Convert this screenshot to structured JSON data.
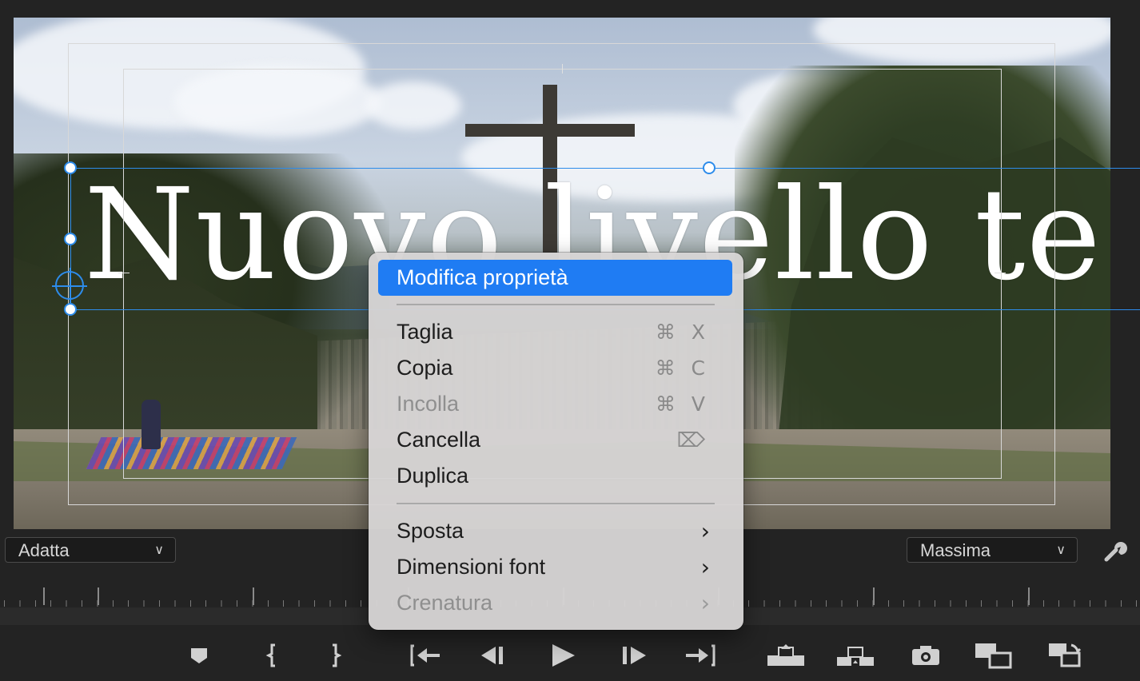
{
  "overlay_text": "Nuovo livello te",
  "zoom_select": {
    "value": "Adatta"
  },
  "quality_select": {
    "value": "Massima"
  },
  "context_menu": {
    "items": [
      {
        "label": "Modifica proprietà",
        "shortcut": "",
        "submenu": false,
        "disabled": false,
        "highlighted": true
      },
      {
        "label": "Taglia",
        "shortcut": "⌘ X",
        "submenu": false,
        "disabled": false,
        "highlighted": false
      },
      {
        "label": "Copia",
        "shortcut": "⌘ C",
        "submenu": false,
        "disabled": false,
        "highlighted": false
      },
      {
        "label": "Incolla",
        "shortcut": "⌘ V",
        "submenu": false,
        "disabled": true,
        "highlighted": false
      },
      {
        "label": "Cancella",
        "shortcut": "⌦",
        "submenu": false,
        "disabled": false,
        "highlighted": false
      },
      {
        "label": "Duplica",
        "shortcut": "",
        "submenu": false,
        "disabled": false,
        "highlighted": false
      },
      {
        "label": "Sposta",
        "shortcut": "",
        "submenu": true,
        "disabled": false,
        "highlighted": false
      },
      {
        "label": "Dimensioni font",
        "shortcut": "",
        "submenu": true,
        "disabled": false,
        "highlighted": false
      },
      {
        "label": "Crenatura",
        "shortcut": "",
        "submenu": true,
        "disabled": true,
        "highlighted": false
      }
    ]
  },
  "transport_controls": [
    "marker-icon",
    "mark-in-icon",
    "mark-out-icon",
    "go-to-in-icon",
    "step-back-icon",
    "play-icon",
    "step-forward-icon",
    "go-to-out-icon",
    "lift-icon",
    "extract-icon",
    "export-frame-icon",
    "comparison-view-icon",
    "toggle-proxies-icon"
  ],
  "colors": {
    "selection": "#2d8ceb",
    "menu_highlight": "#1f7cf3"
  }
}
